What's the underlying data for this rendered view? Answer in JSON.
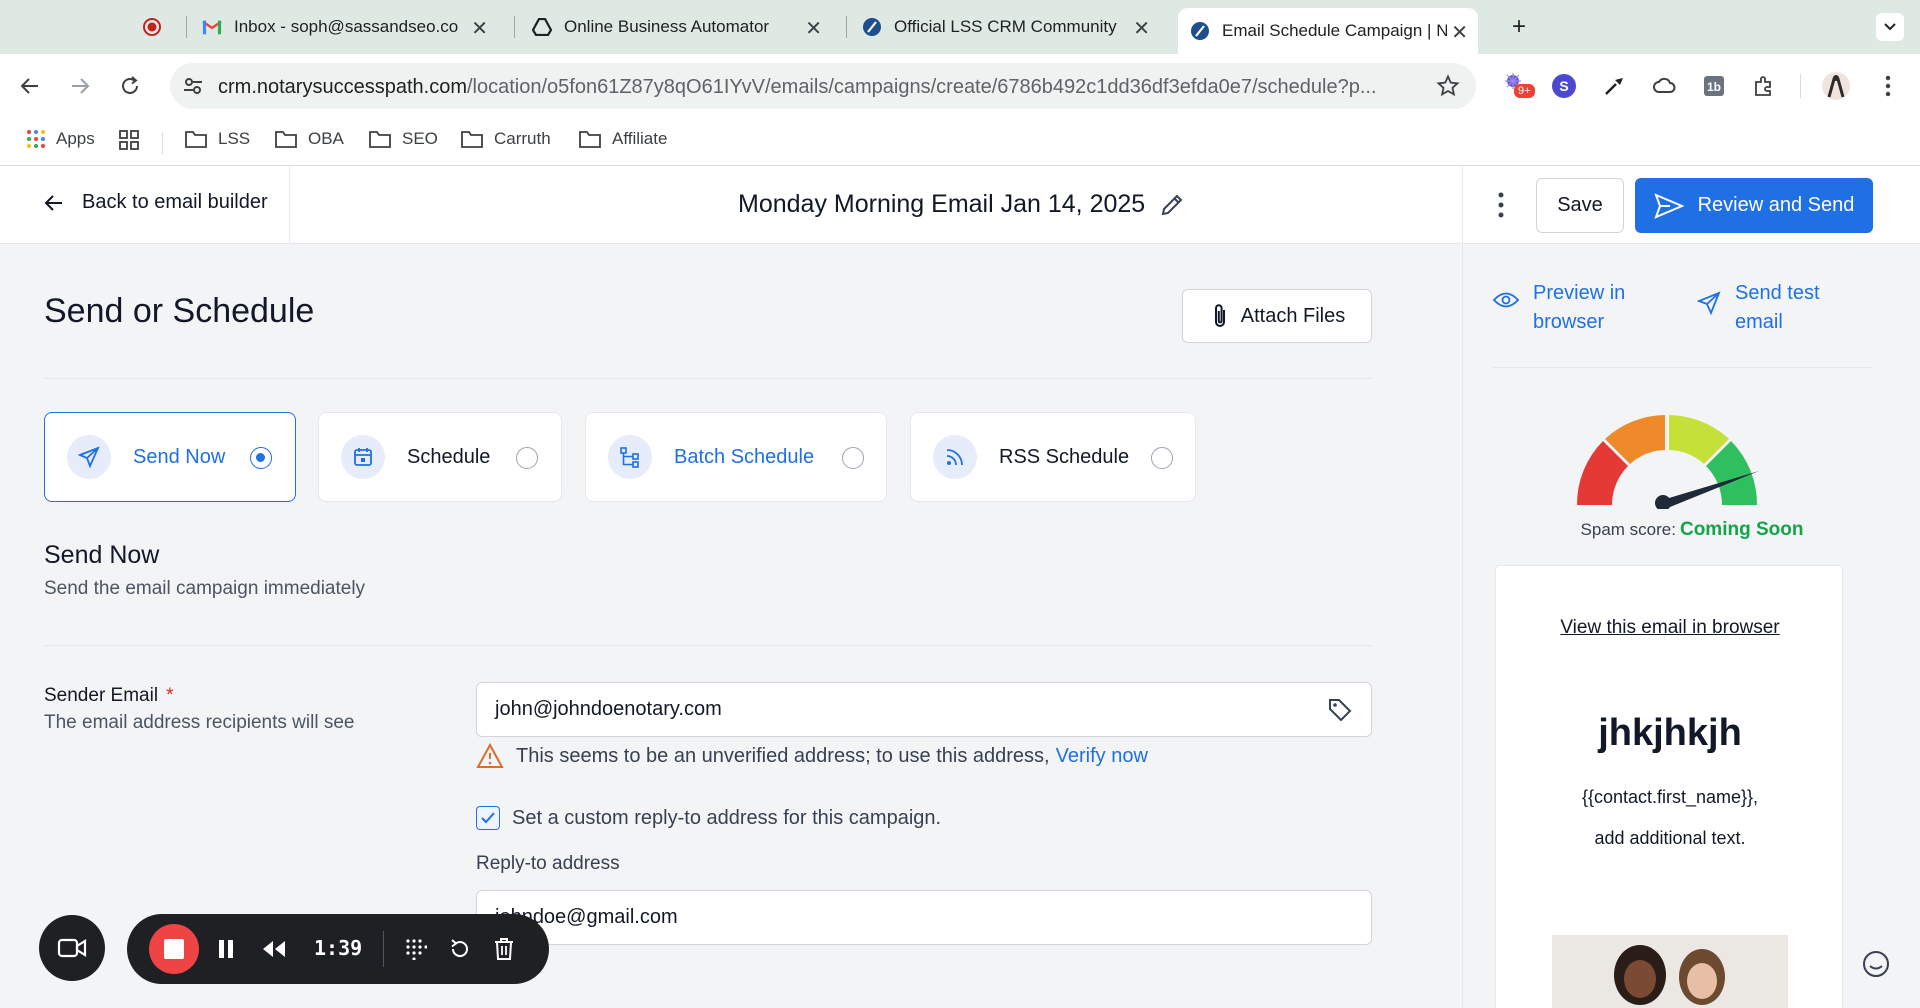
{
  "browser": {
    "tabs": [
      {
        "title": "",
        "favicon": "record-icon"
      },
      {
        "title": "Inbox - soph@sassandseo.co",
        "favicon": "gmail-icon"
      },
      {
        "title": "Online Business Automator",
        "favicon": "drive-icon"
      },
      {
        "title": "Official LSS CRM Community",
        "favicon": "crm-icon"
      },
      {
        "title": "Email Schedule Campaign | N",
        "favicon": "crm-icon",
        "active": true
      }
    ],
    "url_main": "crm.notarysuccesspath.com",
    "url_rest": "/location/o5fon61Z87y8qO61IYvV/emails/campaigns/create/6786b492c1dd36df3efda0e7/schedule?p...",
    "extension_badge": "9+",
    "profile_letter": "S",
    "bookmarks": [
      "Apps",
      "LSS",
      "OBA",
      "SEO",
      "Carruth",
      "Affiliate"
    ]
  },
  "header": {
    "back_label": "Back to email builder",
    "campaign_title": "Monday Morning Email Jan 14, 2025",
    "save_label": "Save",
    "review_label": "Review and Send"
  },
  "main": {
    "title": "Send or Schedule",
    "attach_label": "Attach Files",
    "options": [
      {
        "label": "Send Now",
        "icon": "send-icon",
        "selected": true
      },
      {
        "label": "Schedule",
        "icon": "calendar-icon",
        "selected": false
      },
      {
        "label": "Batch Schedule",
        "icon": "batch-icon",
        "selected": false
      },
      {
        "label": "RSS Schedule",
        "icon": "rss-icon",
        "selected": false
      }
    ],
    "section_title": "Send Now",
    "section_desc": "Send the email campaign immediately",
    "sender": {
      "label": "Sender Email",
      "required_mark": "*",
      "desc": "The email address recipients will see",
      "value": "john@johndoenotary.com",
      "warning": "This seems to be an unverified address; to use this address,",
      "verify_label": "Verify now"
    },
    "custom_reply_label": "Set a custom reply-to address for this campaign.",
    "custom_reply_checked": true,
    "reply_to": {
      "label": "Reply-to address",
      "value": "johndoe@gmail.com"
    }
  },
  "side": {
    "preview_browser_l1": "Preview in",
    "preview_browser_l2": "browser",
    "send_test_l1": "Send test",
    "send_test_l2": "email",
    "spam_label": "Spam score:",
    "spam_value": "Coming Soon",
    "preview": {
      "view_link": "View this email in browser",
      "heading": "jhkjhkjh",
      "line1": "{{contact.first_name}},",
      "line2": "add additional text."
    }
  },
  "recorder": {
    "time": "1:39"
  },
  "colors": {
    "accent": "#1f6fe5",
    "success": "#16a34a",
    "danger": "#dc2626"
  }
}
